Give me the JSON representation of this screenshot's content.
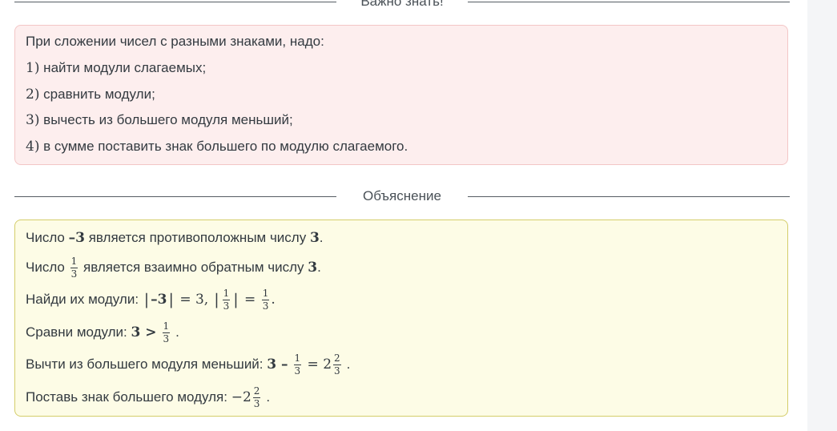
{
  "important": {
    "heading": "Важно знать!",
    "intro": "При сложении чисел с разными знаками, надо:",
    "steps": [
      {
        "num": "1)",
        "text": " найти модули слагаемых;"
      },
      {
        "num": "2)",
        "text": " сравнить модули;"
      },
      {
        "num": "3)",
        "text": " вычесть из большего модуля меньший;"
      },
      {
        "num": "4)",
        "text": " в сумме поставить знак большего по модулю слагаемого."
      }
    ]
  },
  "explanation": {
    "heading": "Объяснение",
    "line1": {
      "a": "Число ",
      "b": "–3",
      "c": " является противоположным числу ",
      "d": "3",
      "e": "."
    },
    "line2": {
      "a": "Число ",
      "num": "1",
      "den": "3",
      "c": " является взаимно обратным числу ",
      "d": "3",
      "e": "."
    },
    "line3": {
      "a": "Найди их модули: ",
      "abs1": "–3",
      "eq1": " = 3,",
      "num1": "1",
      "den1": "3",
      "eq2": " = ",
      "num2": "1",
      "den2": "3",
      "end": "."
    },
    "line4": {
      "a": "Сравни модули: ",
      "b": "3 >",
      "num": "1",
      "den": "3",
      "end": "."
    },
    "line5": {
      "a": "Вычти из большего модуля меньший: ",
      "b": "3 –",
      "num1": "1",
      "den1": "3",
      "eq": " = 2",
      "num2": "2",
      "den2": "3",
      "end": "."
    },
    "line6": {
      "a": "Поставь знак большего модуля: ",
      "b": "−2",
      "num": "2",
      "den": "3",
      "end": "."
    }
  }
}
